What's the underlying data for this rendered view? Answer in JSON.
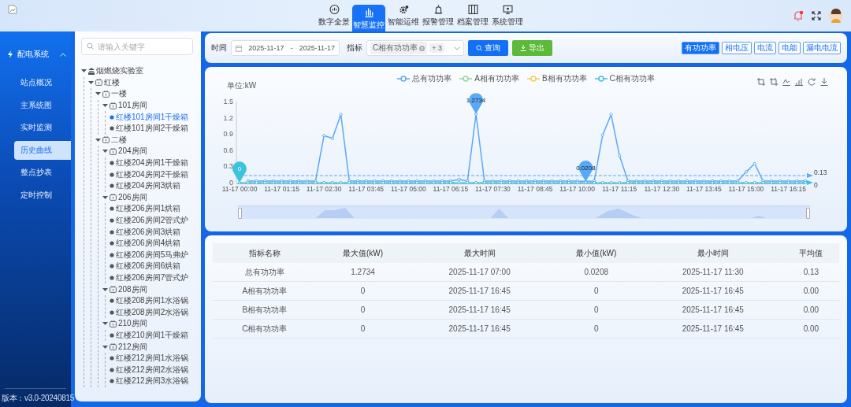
{
  "nav": {
    "items": [
      {
        "label": "数字全景",
        "selected": false
      },
      {
        "label": "智慧监控",
        "selected": true
      },
      {
        "label": "智能运维",
        "selected": false
      },
      {
        "label": "报警管理",
        "selected": false
      },
      {
        "label": "档案管理",
        "selected": false
      },
      {
        "label": "系统管理",
        "selected": false
      }
    ],
    "notification": true
  },
  "sidebar": {
    "group": {
      "label": "配电系统",
      "expanded": true
    },
    "items": [
      {
        "label": "站点概况",
        "selected": false
      },
      {
        "label": "主系统图",
        "selected": false
      },
      {
        "label": "实时监测",
        "selected": false
      },
      {
        "label": "历史曲线",
        "selected": true
      },
      {
        "label": "整点抄表",
        "selected": false
      },
      {
        "label": "定时控制",
        "selected": false
      }
    ],
    "version": "版本：v3.0-20240815"
  },
  "tree": {
    "search_placeholder": "请输入关键字",
    "nodes": [
      {
        "label": "烟燃烧实验室",
        "kind": "site",
        "expanded": true,
        "children": [
          {
            "label": "红楼",
            "kind": "building",
            "expanded": true,
            "children": [
              {
                "label": "一楼",
                "kind": "building",
                "expanded": true,
                "children": [
                  {
                    "label": "101房间",
                    "kind": "building",
                    "expanded": true,
                    "children": [
                      {
                        "label": "红楼101房间1干燥箱",
                        "kind": "device",
                        "selected": true
                      },
                      {
                        "label": "红楼101房间2干燥箱",
                        "kind": "device",
                        "selected": false
                      }
                    ]
                  }
                ]
              },
              {
                "label": "二楼",
                "kind": "building",
                "expanded": true,
                "children": [
                  {
                    "label": "204房间",
                    "kind": "building",
                    "expanded": true,
                    "children": [
                      {
                        "label": "红楼204房间1干燥箱",
                        "kind": "device",
                        "selected": false
                      },
                      {
                        "label": "红楼204房间2干燥箱",
                        "kind": "device",
                        "selected": false
                      },
                      {
                        "label": "红楼204房间3烘箱",
                        "kind": "device",
                        "selected": false
                      }
                    ]
                  },
                  {
                    "label": "206房间",
                    "kind": "building",
                    "expanded": true,
                    "children": [
                      {
                        "label": "红楼206房间1烘箱",
                        "kind": "device",
                        "selected": false
                      },
                      {
                        "label": "红楼206房间2管式炉",
                        "kind": "device",
                        "selected": false
                      },
                      {
                        "label": "红楼206房间3烘箱",
                        "kind": "device",
                        "selected": false
                      },
                      {
                        "label": "红楼206房间4烘箱",
                        "kind": "device",
                        "selected": false
                      },
                      {
                        "label": "红楼206房间5马弗炉",
                        "kind": "device",
                        "selected": false
                      },
                      {
                        "label": "红楼206房间6烘箱",
                        "kind": "device",
                        "selected": false
                      },
                      {
                        "label": "红楼206房间7管式炉",
                        "kind": "device",
                        "selected": false
                      }
                    ]
                  },
                  {
                    "label": "208房间",
                    "kind": "building",
                    "expanded": true,
                    "children": [
                      {
                        "label": "红楼208房间1水浴锅",
                        "kind": "device",
                        "selected": false
                      },
                      {
                        "label": "红楼208房间2水浴锅",
                        "kind": "device",
                        "selected": false
                      }
                    ]
                  },
                  {
                    "label": "210房间",
                    "kind": "building",
                    "expanded": true,
                    "children": [
                      {
                        "label": "红楼210房间1干燥箱",
                        "kind": "device",
                        "selected": false
                      }
                    ]
                  },
                  {
                    "label": "212房间",
                    "kind": "building",
                    "expanded": true,
                    "children": [
                      {
                        "label": "红楼212房间1水浴锅",
                        "kind": "device",
                        "selected": false
                      },
                      {
                        "label": "红楼212房间2水浴锅",
                        "kind": "device",
                        "selected": false
                      },
                      {
                        "label": "红楼212房间3水浴锅",
                        "kind": "device",
                        "selected": false
                      }
                    ]
                  }
                ]
              }
            ]
          }
        ]
      }
    ]
  },
  "filter": {
    "time_label": "时间",
    "start_date": "2025-11-17",
    "separator": "-",
    "end_date": "2025-11-17",
    "metric_label": "指标",
    "metric_tag": "C相有功功率",
    "metric_more": "+ 3",
    "query_button": "查询",
    "export_button": "导出",
    "types": [
      {
        "label": "有功功率",
        "selected": true
      },
      {
        "label": "相电压",
        "selected": false
      },
      {
        "label": "电流",
        "selected": false
      },
      {
        "label": "电能",
        "selected": false
      },
      {
        "label": "漏电电流",
        "selected": false
      }
    ]
  },
  "chart": {
    "chart_data": {
      "type": "line",
      "ylabel": "单位:kW",
      "ylim": [
        0,
        1.5
      ],
      "yticks": [
        0,
        0.3,
        0.6,
        0.9,
        1.2,
        1.5
      ],
      "categories": [
        "11-17 00:00",
        null,
        null,
        null,
        null,
        "11-17 01:15",
        null,
        null,
        null,
        null,
        "11-17 02:30",
        null,
        null,
        null,
        null,
        "11-17 03:45",
        null,
        null,
        null,
        null,
        "11-17 05:00",
        null,
        null,
        null,
        null,
        "11-17 06:15",
        null,
        null,
        null,
        null,
        "11-17 07:30",
        null,
        null,
        null,
        null,
        "11-17 08:45",
        null,
        null,
        null,
        null,
        "11-17 10:00",
        null,
        null,
        null,
        null,
        "11-17 11:15",
        null,
        null,
        null,
        null,
        "11-17 12:30",
        null,
        null,
        null,
        null,
        "11-17 13:45",
        null,
        null,
        null,
        null,
        "11-17 15:00",
        null,
        null,
        null,
        null,
        "11-17 16:15",
        null,
        null
      ],
      "series": [
        {
          "name": "总有功功率",
          "color": "#5aa9f5",
          "marker": "o",
          "values": [
            null,
            0.03,
            0.03,
            0.03,
            0.03,
            0.03,
            0.03,
            0.03,
            0.03,
            0.03,
            0.87,
            0.82,
            1.26,
            0.03,
            0.03,
            0.03,
            0.03,
            0.03,
            0.03,
            0.03,
            0.03,
            0.03,
            0.03,
            0.03,
            0.03,
            0.03,
            0.06,
            0.03,
            1.27,
            0.03,
            0.03,
            0.03,
            0.03,
            0.03,
            0.03,
            0.03,
            0.03,
            0.03,
            0.03,
            0.03,
            0.03,
            0.02,
            0.03,
            0.88,
            1.26,
            0.5,
            0.03,
            0.03,
            0.03,
            0.03,
            0.03,
            0.03,
            0.03,
            0.03,
            0.03,
            0.03,
            0.03,
            0.03,
            0.03,
            0.03,
            0.2,
            0.35,
            0.03,
            0.03,
            0.03,
            0.03,
            0.03,
            0.03
          ]
        },
        {
          "name": "A相有功功率",
          "color": "#91d8a0",
          "values": [
            null,
            null,
            null,
            null,
            null,
            null,
            null,
            null,
            null,
            null,
            null,
            null,
            null,
            null,
            null,
            null,
            null,
            null,
            null,
            null,
            null,
            null,
            null,
            null,
            null,
            null,
            null,
            null,
            null,
            null,
            null,
            null,
            null,
            null,
            null,
            null,
            null,
            null,
            null,
            null,
            null,
            null,
            null,
            null,
            null,
            null,
            null,
            null,
            null,
            null,
            null,
            null,
            null,
            null,
            null,
            null,
            null,
            null,
            null,
            null,
            null,
            null,
            null,
            null,
            null,
            null,
            null,
            null
          ]
        },
        {
          "name": "B相有功功率",
          "color": "#f5cc55",
          "values": [
            null,
            null,
            null,
            null,
            null,
            null,
            null,
            null,
            null,
            null,
            null,
            null,
            null,
            null,
            null,
            null,
            null,
            null,
            null,
            null,
            null,
            null,
            null,
            null,
            null,
            null,
            null,
            null,
            null,
            null,
            null,
            null,
            null,
            null,
            null,
            null,
            null,
            null,
            null,
            null,
            null,
            null,
            null,
            null,
            null,
            null,
            null,
            null,
            null,
            null,
            null,
            null,
            null,
            null,
            null,
            null,
            null,
            null,
            null,
            null,
            null,
            null,
            null,
            null,
            null,
            null,
            null,
            null
          ]
        },
        {
          "name": "C相有功功率",
          "color": "#3cc3dd",
          "marker": "o",
          "values": [
            0,
            0,
            0,
            0,
            0,
            0,
            0,
            0,
            0,
            0,
            0,
            0,
            0,
            0,
            0,
            0,
            0,
            0,
            0,
            0,
            0,
            0,
            0,
            0,
            0,
            0,
            0,
            0,
            0,
            0,
            0,
            0,
            0,
            0,
            0,
            0,
            0,
            0,
            0,
            0,
            0,
            0,
            0,
            0,
            0,
            0,
            0,
            0,
            0,
            0,
            0,
            0,
            0,
            0,
            0,
            0,
            0,
            0,
            0,
            0,
            0,
            0,
            0,
            0,
            0,
            0,
            0,
            0
          ]
        }
      ],
      "annotations": [
        {
          "y": 1.27,
          "text": "1.2734"
        },
        {
          "y": 0.02,
          "text": "0.0208"
        },
        {
          "y": 0,
          "text": "0"
        }
      ],
      "ref_lines": [
        {
          "axis": "y",
          "value": 0.13,
          "label": "0.13",
          "color": "#5aa9f5"
        },
        {
          "axis": "y",
          "value": 0,
          "label": "0",
          "color": "#3cc3dd"
        }
      ]
    },
    "slider": {
      "level": 1
    }
  },
  "table": {
    "columns": [
      "指标名称",
      "最大值(kW)",
      "最大时间",
      "最小值(kW)",
      "最小时间",
      "平均值"
    ],
    "rows": [
      [
        "总有功功率",
        "1.2734",
        "2025-11-17 07:00",
        "0.0208",
        "2025-11-17 11:30",
        "0.13"
      ],
      [
        "A相有功功率",
        "0",
        "2025-11-17 16:45",
        "0",
        "2025-11-17 16:45",
        "0.00"
      ],
      [
        "B相有功功率",
        "0",
        "2025-11-17 16:45",
        "0",
        "2025-11-17 16:45",
        "0.00"
      ],
      [
        "C相有功功率",
        "0",
        "2025-11-17 16:45",
        "0",
        "2025-11-17 16:45",
        "0.00"
      ]
    ]
  }
}
